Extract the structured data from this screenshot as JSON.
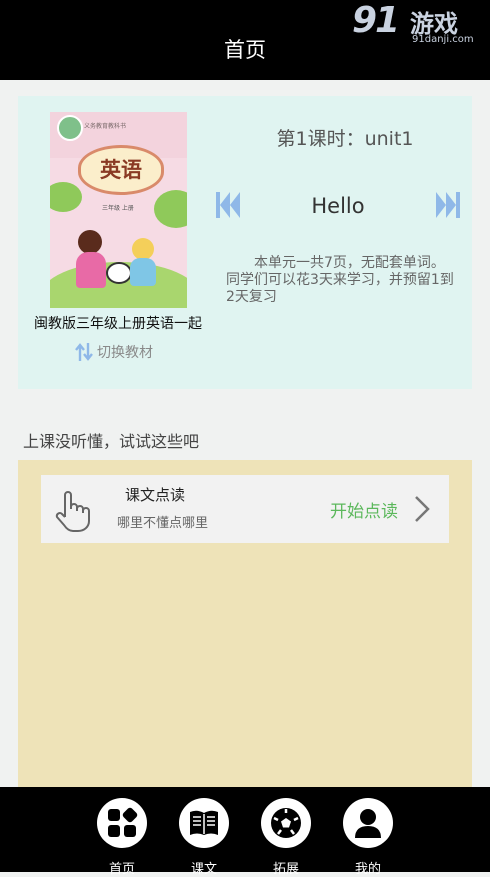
{
  "watermark": {
    "logo": "91",
    "name": "游戏",
    "url": "91danji.com"
  },
  "header": {
    "title": "首页"
  },
  "book": {
    "cover_title": "英语",
    "cover_publisher_text": "义务教育教科书",
    "cover_grade_text": "三年级 上册",
    "name": "闽教版三年级上册英语一起",
    "switch_label": "切换教材"
  },
  "lesson": {
    "title": "第1课时：unit1",
    "word": "Hello",
    "description": "本单元一共7页，无配套单词。同学们可以花3天来学习，并预留1到2天复习"
  },
  "section": {
    "label": "上课没听懂，试试这些吧"
  },
  "feature": {
    "name": "课文点读",
    "subtitle": "哪里不懂点哪里",
    "action": "开始点读"
  },
  "tabs": [
    {
      "label": "首页",
      "icon": "home-grid-icon"
    },
    {
      "label": "课文",
      "icon": "book-icon"
    },
    {
      "label": "拓展",
      "icon": "ball-icon"
    },
    {
      "label": "我的",
      "icon": "user-icon"
    }
  ],
  "colors": {
    "header_bg": "#000000",
    "card_bg": "#e0f4f1",
    "panel_bg": "#eee3b8",
    "accent_green": "#5cb85c",
    "nav_arrow_blue": "#8fb8e8"
  }
}
